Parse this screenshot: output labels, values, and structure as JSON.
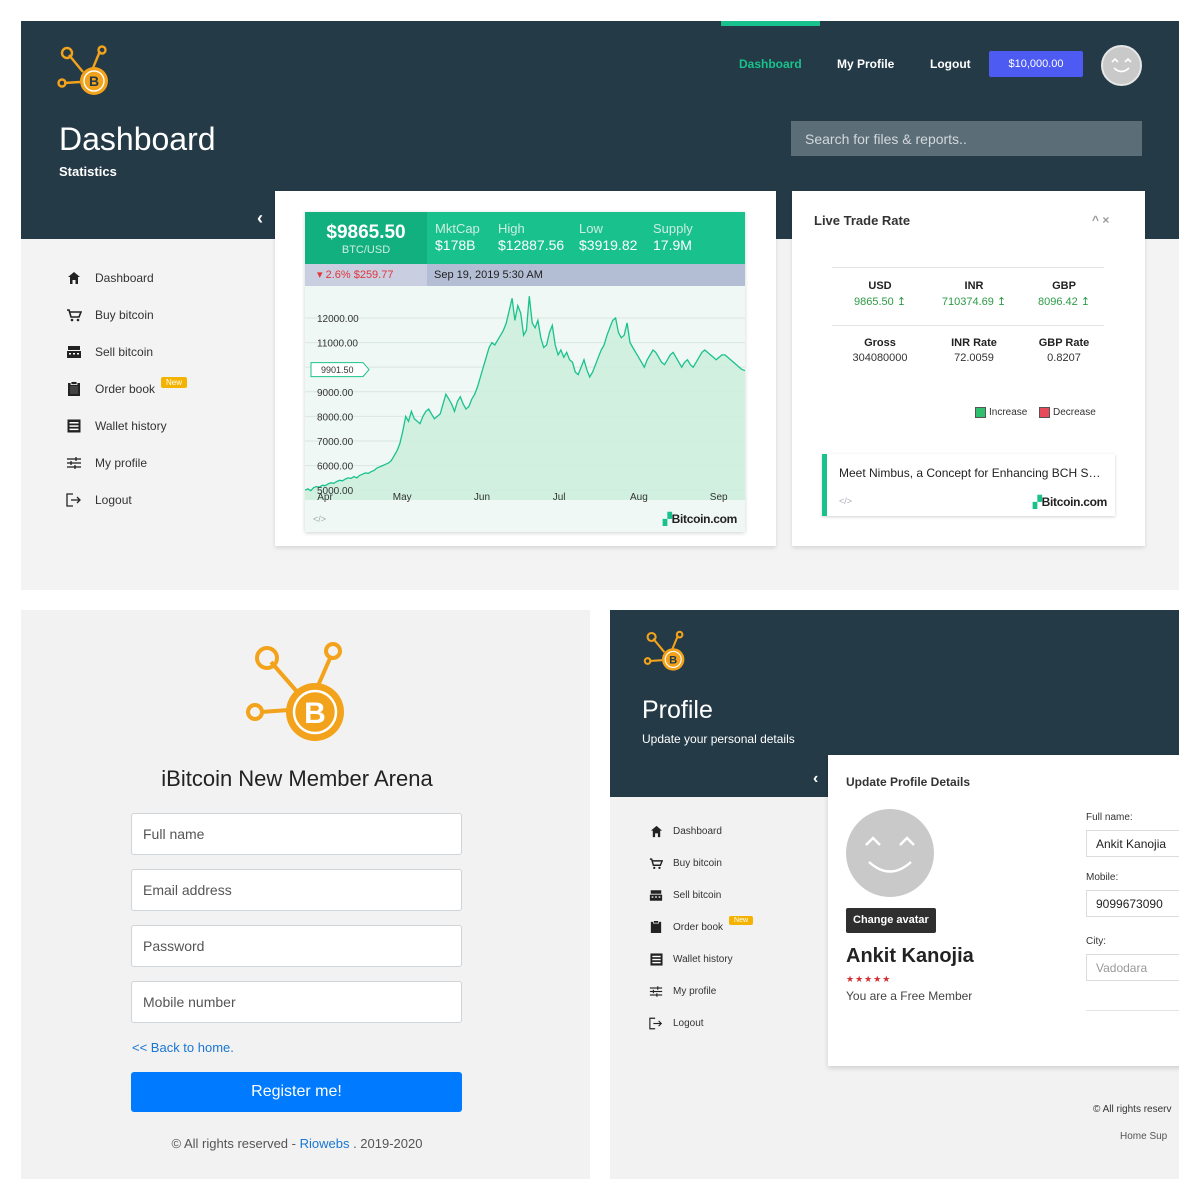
{
  "colors": {
    "header_bg": "#243a46",
    "accent_green": "#19c28d",
    "balance_blue": "#4d5bf2",
    "logo_orange": "#f3a31b",
    "register_blue": "#007bff"
  },
  "dashboard": {
    "nav": {
      "dashboard": "Dashboard",
      "my_profile": "My Profile",
      "logout": "Logout",
      "balance": "$10,000.00"
    },
    "title": "Dashboard",
    "subtitle": "Statistics",
    "search_placeholder": "Search for files & reports..",
    "collapse_glyph": "‹",
    "sidebar": [
      {
        "label": "Dashboard",
        "icon": "home-icon"
      },
      {
        "label": "Buy bitcoin",
        "icon": "cart-icon"
      },
      {
        "label": "Sell bitcoin",
        "icon": "cash-register-icon"
      },
      {
        "label": "Order book",
        "icon": "clipboard-icon",
        "badge": "New"
      },
      {
        "label": "Wallet history",
        "icon": "list-icon"
      },
      {
        "label": "My profile",
        "icon": "sliders-icon"
      },
      {
        "label": "Logout",
        "icon": "logout-icon"
      }
    ],
    "widget": {
      "price": "$9865.50",
      "pair": "BTC/USD",
      "stats": [
        {
          "label": "MktCap",
          "value": "$178B"
        },
        {
          "label": "High",
          "value": "$12887.56"
        },
        {
          "label": "Low",
          "value": "$3919.82"
        },
        {
          "label": "Supply",
          "value": "17.9M"
        }
      ],
      "change": "▾ 2.6%  $259.77",
      "date": "Sep 19, 2019 5:30 AM",
      "current_marker": "9901.50",
      "credit": "Bitcoin.com",
      "code": "</>"
    },
    "live_trade": {
      "title": "Live Trade Rate",
      "controls": "^  ×",
      "rates": [
        {
          "label": "USD",
          "value": "9865.50 ↥"
        },
        {
          "label": "INR",
          "value": "710374.69 ↥"
        },
        {
          "label": "GBP",
          "value": "8096.42 ↥"
        }
      ],
      "stats": [
        {
          "label": "Gross",
          "value": "304080000"
        },
        {
          "label": "INR Rate",
          "value": "72.0059"
        },
        {
          "label": "GBP Rate",
          "value": "0.8207"
        }
      ],
      "legend": {
        "increase": "Increase",
        "decrease": "Decrease",
        "increase_color": "#2fbf6e",
        "decrease_color": "#e84a5a"
      },
      "news": {
        "text": "Meet Nimbus, a Concept for Enhancing BCH S…",
        "code": "</>",
        "credit": "Bitcoin.com"
      }
    }
  },
  "chart_data": {
    "type": "area",
    "x_tick_labels": [
      "Apr",
      "May",
      "Jun",
      "Jul",
      "Aug",
      "Sep"
    ],
    "y_tick_labels": [
      "5000.00",
      "6000.00",
      "7000.00",
      "8000.00",
      "9000.00",
      "11000.00",
      "12000.00"
    ],
    "ylim": [
      4600,
      13300
    ],
    "xlim": [
      0,
      171
    ],
    "x_tick_days": [
      0,
      30,
      61,
      91,
      122,
      153
    ],
    "series": [
      {
        "values": [
          5000,
          5050,
          4980,
          5100,
          5150,
          5120,
          5200,
          5180,
          5250,
          5300,
          5280,
          5350,
          5400,
          5380,
          5450,
          5500,
          5480,
          5550,
          5500,
          5600,
          5650,
          5700,
          5680,
          5750,
          5800,
          5900,
          5950,
          6000,
          6050,
          6100,
          6200,
          6400,
          6600,
          6900,
          7400,
          8000,
          7800,
          8200,
          7900,
          7800,
          7700,
          8000,
          8200,
          8300,
          8100,
          7900,
          8000,
          8100,
          8500,
          8900,
          8700,
          8500,
          8200,
          8600,
          8800,
          8500,
          8300,
          8400,
          8700,
          8900,
          9200,
          9600,
          10000,
          10400,
          10800,
          11000,
          10900,
          11100,
          11300,
          11500,
          11800,
          12300,
          12800,
          11900,
          12500,
          12200,
          11300,
          11500,
          12887,
          11800,
          11600,
          11900,
          11200,
          10800,
          10900,
          11400,
          11700,
          10900,
          10500,
          10700,
          10400,
          10600,
          10300,
          10200,
          9800,
          9700,
          10000,
          10300,
          9900,
          9600,
          9800,
          10100,
          10400,
          10700,
          10900,
          11300,
          11600,
          11900,
          12000,
          11400,
          11200,
          11300,
          11800,
          11000,
          10800,
          10600,
          10400,
          10200,
          10000,
          10300,
          10500,
          10700,
          10600,
          10400,
          10200,
          10100,
          10300,
          10500,
          10600,
          10400,
          10200,
          10000,
          10200,
          10300,
          10100,
          10000,
          10200,
          10400,
          10600,
          10700,
          10600,
          10500,
          10400,
          10300,
          10400,
          10500,
          10500,
          10400,
          10300,
          10200,
          10100,
          10000,
          9900,
          9865
        ]
      }
    ]
  },
  "register": {
    "heading": "iBitcoin New Member Arena",
    "fields": [
      "Full name",
      "Email address",
      "Password",
      "Mobile number"
    ],
    "back_link": "<< Back to home.",
    "button": "Register me!",
    "footer_prefix": "© All rights reserved -",
    "footer_link": "Riowebs",
    "footer_suffix": ". 2019-2020"
  },
  "profile": {
    "title": "Profile",
    "subtitle": "Update your personal details",
    "collapse_glyph": "‹",
    "card_title": "Update Profile Details",
    "change_avatar": "Change avatar",
    "name": "Ankit Kanojia",
    "stars": "★★★★★",
    "member_status": "You are a Free Member",
    "fields": [
      {
        "label": "Full name:",
        "value": "Ankit Kanojia",
        "placeholder": ""
      },
      {
        "label": "Mobile:",
        "value": "9099673090",
        "placeholder": ""
      },
      {
        "label": "City:",
        "value": "",
        "placeholder": "Vadodara"
      }
    ],
    "footer_rights": "© All rights reserv",
    "footer_links": "Home  Sup"
  }
}
